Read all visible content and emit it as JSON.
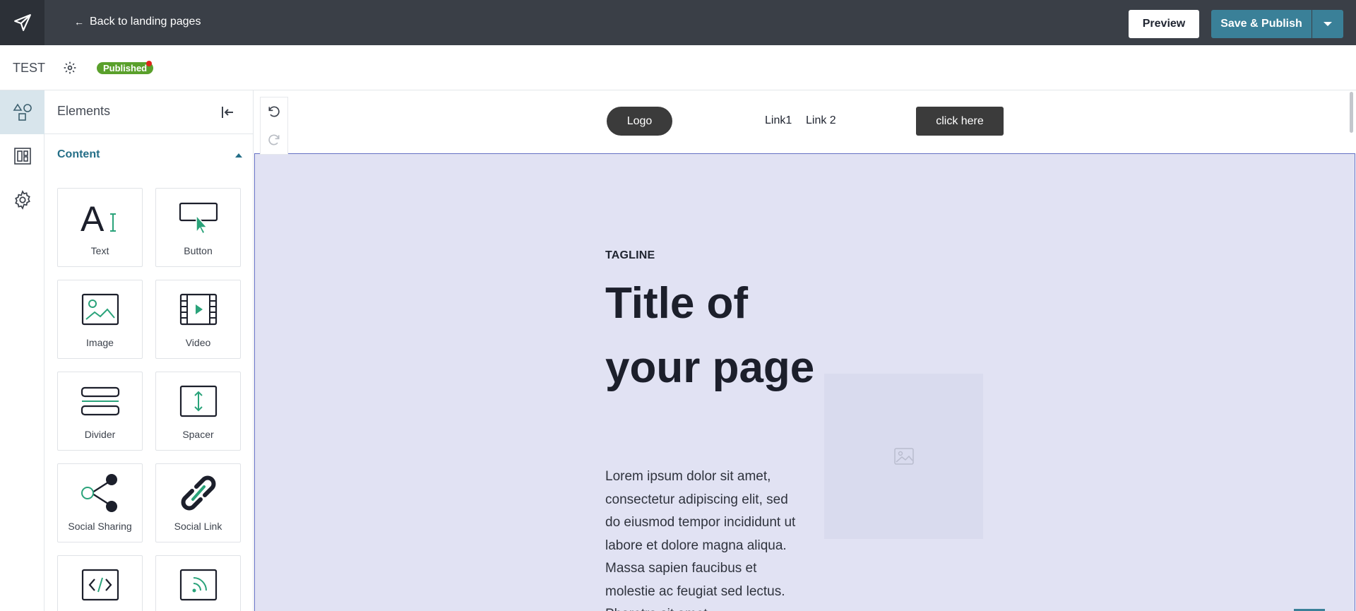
{
  "topbar": {
    "back_label": "Back to landing pages",
    "preview_label": "Preview",
    "publish_label": "Save & Publish"
  },
  "subbar": {
    "page_name": "TEST",
    "status": "Published"
  },
  "panel": {
    "title": "Elements",
    "section": "Content",
    "tiles": [
      {
        "label": "Text",
        "icon": "text-icon"
      },
      {
        "label": "Button",
        "icon": "button-icon"
      },
      {
        "label": "Image",
        "icon": "image-icon"
      },
      {
        "label": "Video",
        "icon": "video-icon"
      },
      {
        "label": "Divider",
        "icon": "divider-icon"
      },
      {
        "label": "Spacer",
        "icon": "spacer-icon"
      },
      {
        "label": "Social Sharing",
        "icon": "social-sharing-icon"
      },
      {
        "label": "Social Link",
        "icon": "social-link-icon"
      },
      {
        "label": "",
        "icon": "code-icon"
      },
      {
        "label": "",
        "icon": "rss-icon"
      }
    ]
  },
  "canvas": {
    "nav": {
      "logo": "Logo",
      "link1": "Link1",
      "link2": "Link 2",
      "cta": "click here"
    },
    "hero": {
      "tagline": "TAGLINE",
      "title": "Title of your page",
      "body": "Lorem ipsum dolor sit amet, consectetur adipiscing elit, sed do eiusmod tempor incididunt ut labore et dolore magna aliqua. Massa sapien faucibus et molestie ac feugiat sed lectus. Pharetra sit amet"
    }
  },
  "colors": {
    "topbar": "#3a3f47",
    "accent": "#3a8098",
    "published": "#5aa02c",
    "hero_bg": "#e1e2f3",
    "icon_green": "#2aa37a"
  }
}
